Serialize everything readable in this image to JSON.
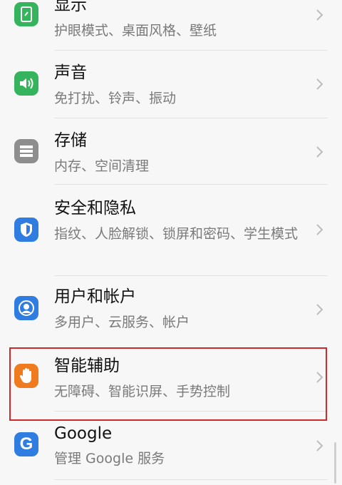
{
  "settings": {
    "items": [
      {
        "title": "显示",
        "subtitle": "护眼模式、桌面风格、壁纸",
        "icon": "display-icon",
        "color": "#35b45d"
      },
      {
        "title": "声音",
        "subtitle": "免打扰、铃声、振动",
        "icon": "sound-icon",
        "color": "#35b45d"
      },
      {
        "title": "存储",
        "subtitle": "内存、空间清理",
        "icon": "storage-icon",
        "color": "#8e8e8e"
      },
      {
        "title": "安全和隐私",
        "subtitle": "指纹、人脸解锁、锁屏和密码、学生模式",
        "icon": "shield-icon",
        "color": "#2f7de1"
      },
      {
        "title": "用户和帐户",
        "subtitle": "多用户、云服务、帐户",
        "icon": "user-icon",
        "color": "#2f7de1"
      },
      {
        "title": "智能辅助",
        "subtitle": "无障碍、智能识屏、手势控制",
        "icon": "hand-icon",
        "color": "#f07a1e"
      },
      {
        "title": "Google",
        "subtitle": "管理 Google 服务",
        "icon": "google-icon",
        "color": "#2f7de1"
      }
    ]
  },
  "colors": {
    "highlight": "#d0292b",
    "background": "#f7f7f7"
  }
}
